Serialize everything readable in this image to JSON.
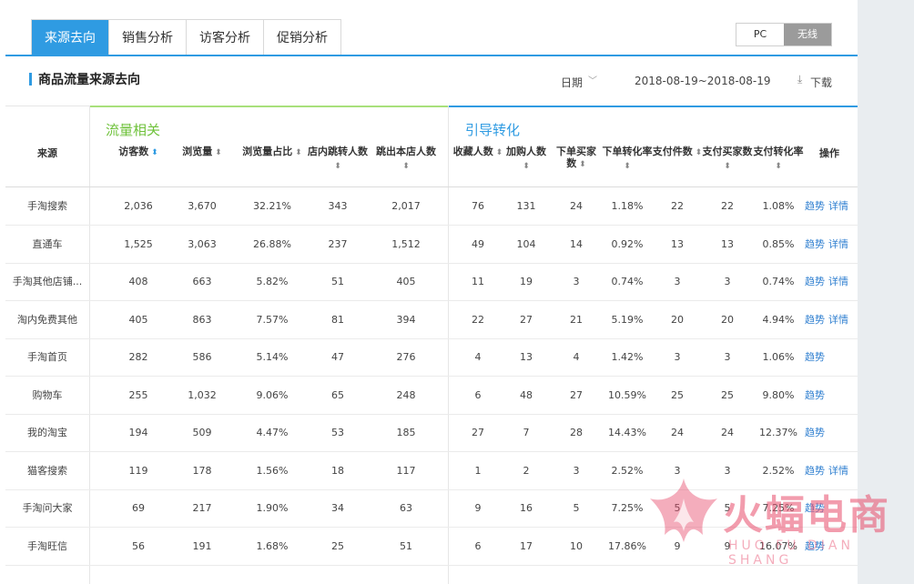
{
  "tabs": [
    {
      "label": "来源去向",
      "active": true
    },
    {
      "label": "销售分析",
      "active": false
    },
    {
      "label": "访客分析",
      "active": false
    },
    {
      "label": "促销分析",
      "active": false
    }
  ],
  "device": {
    "pc": "PC",
    "wireless": "无线",
    "selected": "无线"
  },
  "section": {
    "title": "商品流量来源去向",
    "date_label": "日期",
    "date_range": "2018-08-19~2018-08-19",
    "download": "下载"
  },
  "groups": {
    "traffic": "流量相关",
    "conversion": "引导转化"
  },
  "columns": {
    "source": "来源",
    "visitors": "访客数",
    "pageviews": "浏览量",
    "pv_share": "浏览量占比",
    "inner_jump": "店内跳转人数",
    "bounce": "跳出本店人数",
    "favorites": "收藏人数",
    "add_cart": "加购人数",
    "buyers": "下单买家数",
    "order_rate": "下单转化率",
    "pay_items": "支付件数",
    "pay_buyers": "支付买家数",
    "pay_rate": "支付转化率",
    "actions": "操作"
  },
  "op_labels": {
    "trend": "趋势",
    "detail": "详情"
  },
  "rows": [
    {
      "source": "手淘搜索",
      "visitors": "2,036",
      "pageviews": "3,670",
      "pv_share": "32.21%",
      "inner_jump": "343",
      "bounce": "2,017",
      "favorites": "76",
      "add_cart": "131",
      "buyers": "24",
      "order_rate": "1.18%",
      "pay_items": "22",
      "pay_buyers": "22",
      "pay_rate": "1.08%",
      "has_detail": true
    },
    {
      "source": "直通车",
      "visitors": "1,525",
      "pageviews": "3,063",
      "pv_share": "26.88%",
      "inner_jump": "237",
      "bounce": "1,512",
      "favorites": "49",
      "add_cart": "104",
      "buyers": "14",
      "order_rate": "0.92%",
      "pay_items": "13",
      "pay_buyers": "13",
      "pay_rate": "0.85%",
      "has_detail": true
    },
    {
      "source": "手淘其他店铺...",
      "visitors": "408",
      "pageviews": "663",
      "pv_share": "5.82%",
      "inner_jump": "51",
      "bounce": "405",
      "favorites": "11",
      "add_cart": "19",
      "buyers": "3",
      "order_rate": "0.74%",
      "pay_items": "3",
      "pay_buyers": "3",
      "pay_rate": "0.74%",
      "has_detail": true
    },
    {
      "source": "淘内免费其他",
      "visitors": "405",
      "pageviews": "863",
      "pv_share": "7.57%",
      "inner_jump": "81",
      "bounce": "394",
      "favorites": "22",
      "add_cart": "27",
      "buyers": "21",
      "order_rate": "5.19%",
      "pay_items": "20",
      "pay_buyers": "20",
      "pay_rate": "4.94%",
      "has_detail": true
    },
    {
      "source": "手淘首页",
      "visitors": "282",
      "pageviews": "586",
      "pv_share": "5.14%",
      "inner_jump": "47",
      "bounce": "276",
      "favorites": "4",
      "add_cart": "13",
      "buyers": "4",
      "order_rate": "1.42%",
      "pay_items": "3",
      "pay_buyers": "3",
      "pay_rate": "1.06%",
      "has_detail": false
    },
    {
      "source": "购物车",
      "visitors": "255",
      "pageviews": "1,032",
      "pv_share": "9.06%",
      "inner_jump": "65",
      "bounce": "248",
      "favorites": "6",
      "add_cart": "48",
      "buyers": "27",
      "order_rate": "10.59%",
      "pay_items": "25",
      "pay_buyers": "25",
      "pay_rate": "9.80%",
      "has_detail": false
    },
    {
      "source": "我的淘宝",
      "visitors": "194",
      "pageviews": "509",
      "pv_share": "4.47%",
      "inner_jump": "53",
      "bounce": "185",
      "favorites": "27",
      "add_cart": "7",
      "buyers": "28",
      "order_rate": "14.43%",
      "pay_items": "24",
      "pay_buyers": "24",
      "pay_rate": "12.37%",
      "has_detail": false
    },
    {
      "source": "猫客搜索",
      "visitors": "119",
      "pageviews": "178",
      "pv_share": "1.56%",
      "inner_jump": "18",
      "bounce": "117",
      "favorites": "1",
      "add_cart": "2",
      "buyers": "3",
      "order_rate": "2.52%",
      "pay_items": "3",
      "pay_buyers": "3",
      "pay_rate": "2.52%",
      "has_detail": true
    },
    {
      "source": "手淘问大家",
      "visitors": "69",
      "pageviews": "217",
      "pv_share": "1.90%",
      "inner_jump": "34",
      "bounce": "63",
      "favorites": "9",
      "add_cart": "16",
      "buyers": "5",
      "order_rate": "7.25%",
      "pay_items": "5",
      "pay_buyers": "5",
      "pay_rate": "7.25%",
      "has_detail": false
    },
    {
      "source": "手淘旺信",
      "visitors": "56",
      "pageviews": "191",
      "pv_share": "1.68%",
      "inner_jump": "25",
      "bounce": "51",
      "favorites": "6",
      "add_cart": "17",
      "buyers": "10",
      "order_rate": "17.86%",
      "pay_items": "9",
      "pay_buyers": "9",
      "pay_rate": "16.07%",
      "has_detail": false
    }
  ],
  "watermark": {
    "text": "火蝠电商",
    "sub": "HUO FU DIAN SHANG"
  }
}
